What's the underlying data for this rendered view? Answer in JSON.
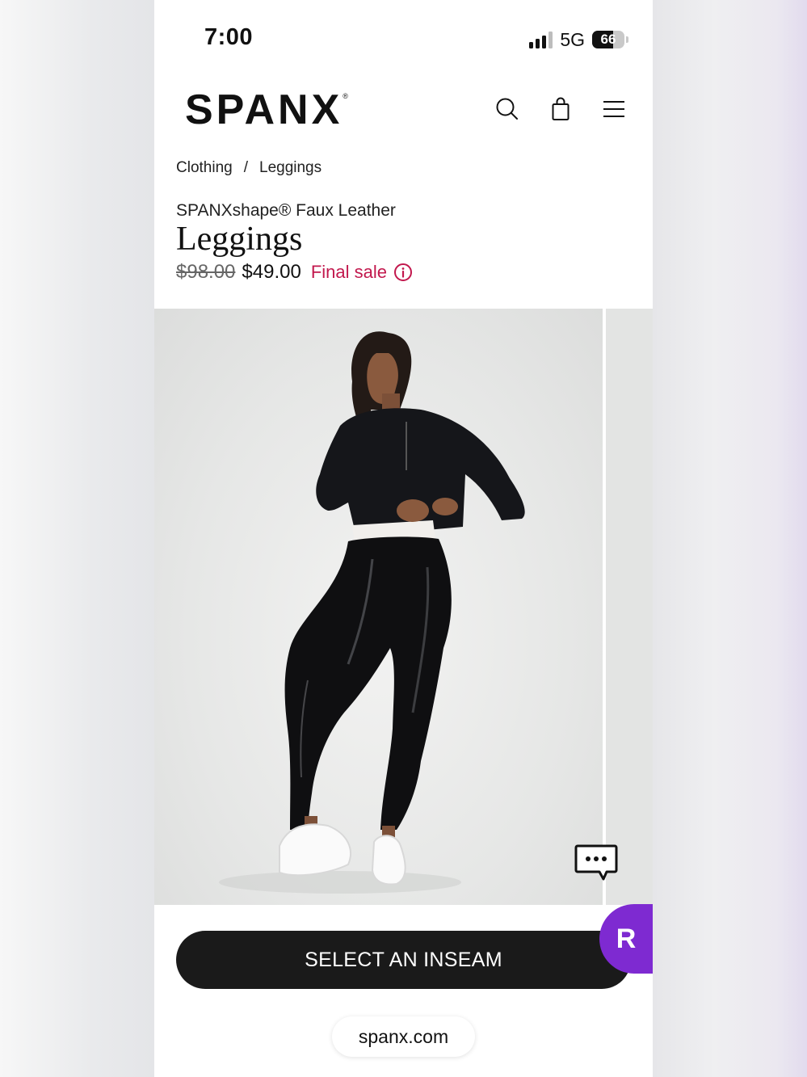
{
  "status_bar": {
    "time": "7:00",
    "network": "5G",
    "battery": "66"
  },
  "header": {
    "logo": "SPANX",
    "logo_mark": "®",
    "icons": [
      "search-icon",
      "shopping-bag-icon",
      "menu-icon"
    ]
  },
  "breadcrumb": {
    "items": [
      "Clothing",
      "Leggings"
    ],
    "separator": "/"
  },
  "product": {
    "subtitle": "SPANXshape® Faux Leather",
    "title": "Leggings",
    "original_price": "$98.00",
    "sale_price": "$49.00",
    "sale_label": "Final sale"
  },
  "actions": {
    "cta_label": "SELECT AN INSEAM",
    "rewards_badge": "R"
  },
  "browser": {
    "url": "spanx.com"
  },
  "colors": {
    "accent_sale": "#c2184d",
    "cta_bg": "#1a1a1a",
    "rewards_purple": "#7e2ad1"
  }
}
